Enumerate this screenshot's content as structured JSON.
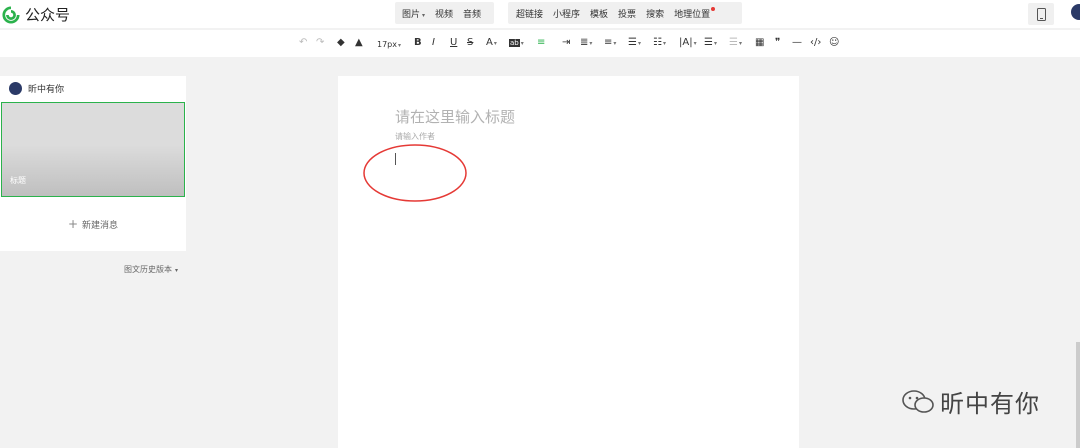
{
  "app": {
    "title": "公众号"
  },
  "insert_menu": {
    "group1": [
      {
        "label": "图片",
        "dropdown": true
      },
      {
        "label": "视频",
        "dropdown": false
      },
      {
        "label": "音频",
        "dropdown": false
      }
    ],
    "group2": [
      {
        "label": "超链接",
        "dropdown": false
      },
      {
        "label": "小程序",
        "dropdown": false
      },
      {
        "label": "模板",
        "dropdown": false
      },
      {
        "label": "投票",
        "dropdown": false
      },
      {
        "label": "搜索",
        "dropdown": false
      },
      {
        "label": "地理位置",
        "dropdown": false,
        "badge": true
      }
    ]
  },
  "format_toolbar": {
    "font_size": "17px",
    "bold": "B",
    "italic": "I",
    "underline": "U",
    "strike": "S",
    "font_color": "A",
    "bg_color": "ab",
    "quote": "❞",
    "hr": "—",
    "code": "‹/›"
  },
  "sidebar": {
    "account_name": "昕中有你",
    "card_label": "标题",
    "new_message": "新建消息",
    "history": "图文历史版本"
  },
  "editor": {
    "title_placeholder": "请在这里输入标题",
    "author_placeholder": "请输入作者"
  },
  "watermark": {
    "text": "昕中有你"
  },
  "colors": {
    "accent": "#2bb24c",
    "annotation": "#e53935"
  }
}
